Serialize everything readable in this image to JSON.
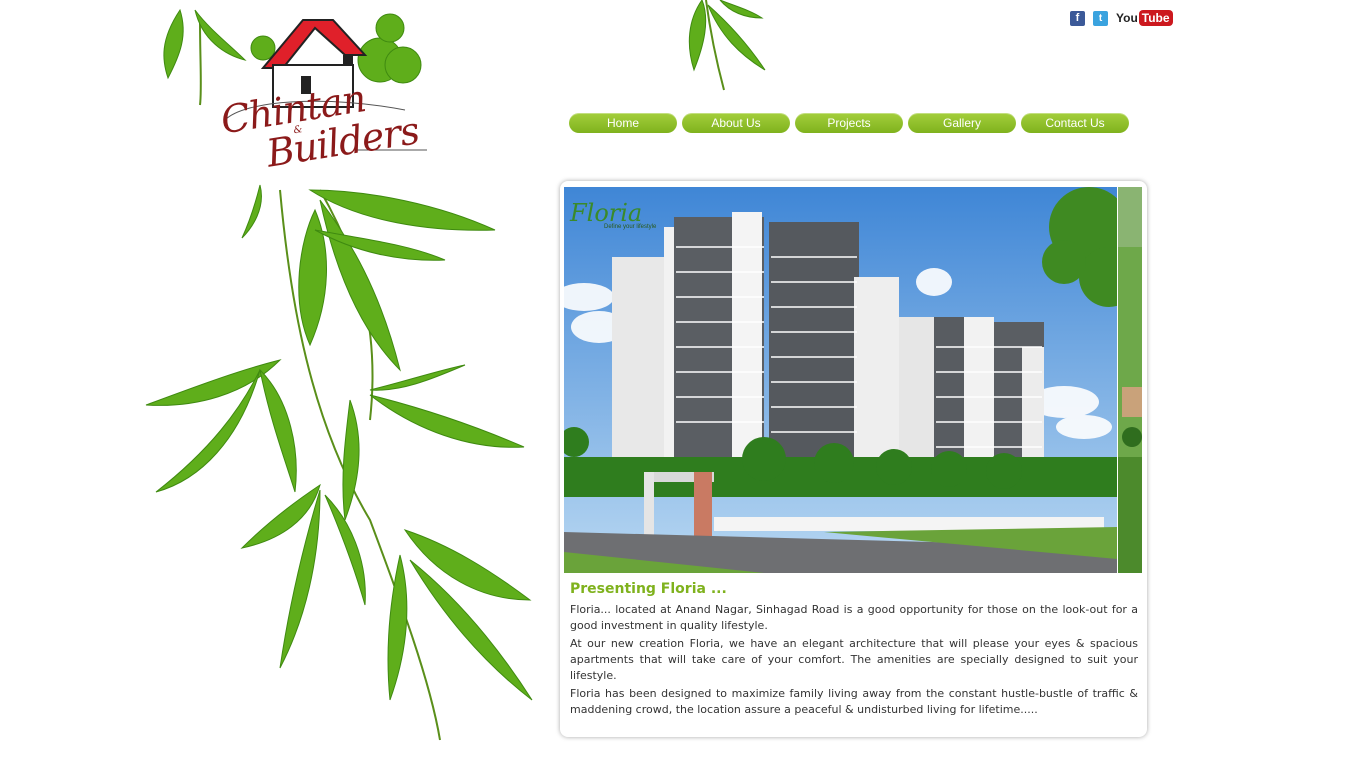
{
  "site": {
    "logo": {
      "line1": "Chintan",
      "amp": "&",
      "line2": "Builders"
    }
  },
  "social": [
    {
      "name": "facebook-icon",
      "glyph": "f"
    },
    {
      "name": "twitter-icon",
      "glyph": "t"
    }
  ],
  "youtube": {
    "you": "You",
    "tube": "Tube"
  },
  "nav": {
    "items": [
      {
        "label": "Home"
      },
      {
        "label": "About Us"
      },
      {
        "label": "Projects"
      },
      {
        "label": "Gallery"
      },
      {
        "label": "Contact Us"
      }
    ]
  },
  "feature": {
    "image_logo": "Floria",
    "image_tagline": "Define your lifestyle",
    "title": "Presenting Floria ...",
    "paragraphs": [
      "Floria... located at Anand Nagar, Sinhagad Road is a good opportunity for those on the look-out for a good investment in quality lifestyle.",
      "At our new creation Floria, we have an elegant architecture that will please your eyes & spacious apartments that will take care of your comfort. The amenities are specially designed to suit your lifestyle.",
      "Floria has been designed to maximize family living away from the constant hustle-bustle of traffic & maddening crowd, the location assure a peaceful & undisturbed living for lifetime....."
    ]
  },
  "colors": {
    "nav_green": "#8dbf27",
    "title_green": "#7fb21d",
    "logo_red": "#8b1a1a",
    "roof_red": "#e0202a",
    "youtube_red": "#cc181e",
    "facebook_blue": "#3b5998",
    "twitter_blue": "#3aa3df"
  }
}
